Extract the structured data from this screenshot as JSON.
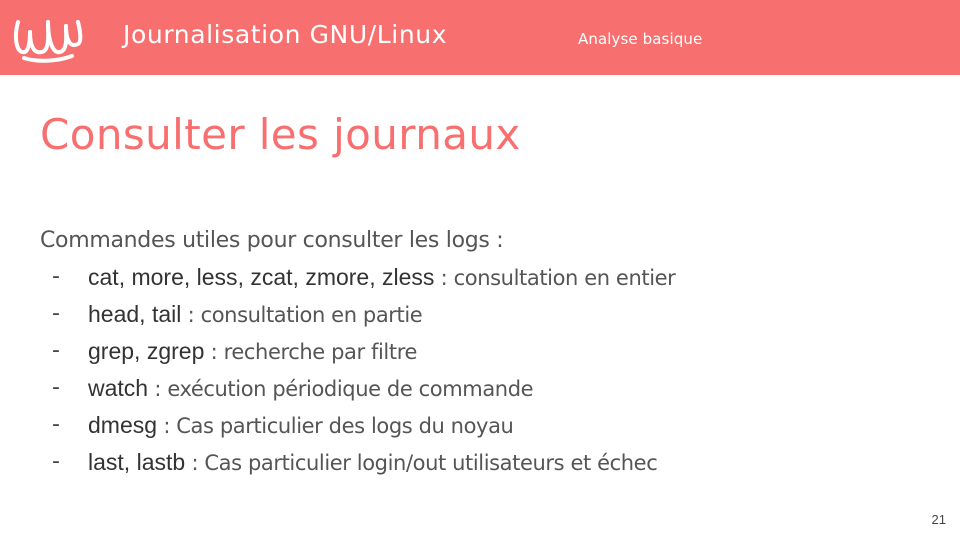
{
  "header": {
    "title": "Journalisation GNU/Linux",
    "subtitle": "Analyse basique",
    "logo_icon": "wave-logo-icon",
    "background_color": "#f76f6f"
  },
  "slide": {
    "title": "Consulter les journaux",
    "intro": "Commandes utiles pour consulter les logs :",
    "items": [
      {
        "dash": "-",
        "commands": [
          "cat",
          "more",
          "less",
          "zcat",
          "zmore",
          "zless"
        ],
        "separator": ", ",
        "description": " : consultation en entier"
      },
      {
        "dash": "-",
        "commands": [
          "head",
          "tail"
        ],
        "separator": ", ",
        "description": " : consultation en partie"
      },
      {
        "dash": "-",
        "commands": [
          "grep",
          "zgrep"
        ],
        "separator": ", ",
        "description": " : recherche par filtre"
      },
      {
        "dash": "-",
        "commands": [
          "watch"
        ],
        "separator": ", ",
        "description": " : exécution périodique de commande"
      },
      {
        "dash": "-",
        "commands": [
          "dmesg"
        ],
        "separator": ", ",
        "description": " : Cas particulier des logs du noyau"
      },
      {
        "dash": "-",
        "commands": [
          "last",
          "lastb"
        ],
        "separator": ", ",
        "description": " : Cas particulier login/out utilisateurs et échec"
      }
    ],
    "page_number": "21",
    "title_color": "#f76f6f"
  }
}
